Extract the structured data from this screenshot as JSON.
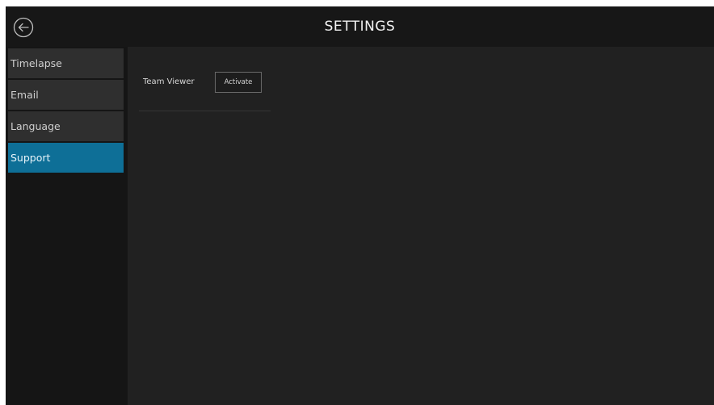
{
  "header": {
    "title": "SETTINGS",
    "back_icon": "back-arrow-circle-icon"
  },
  "sidebar": {
    "items": [
      {
        "label": "Timelapse",
        "active": false
      },
      {
        "label": "Email",
        "active": false
      },
      {
        "label": "Language",
        "active": false
      },
      {
        "label": "Support",
        "active": true
      }
    ]
  },
  "support": {
    "team_viewer_label": "Team Viewer",
    "activate_label": "Activate"
  },
  "colors": {
    "accent": "#0e6f97",
    "background": "#212121",
    "header": "#171717",
    "sidebar": "#151515",
    "nav_item": "#2f2f2f"
  }
}
